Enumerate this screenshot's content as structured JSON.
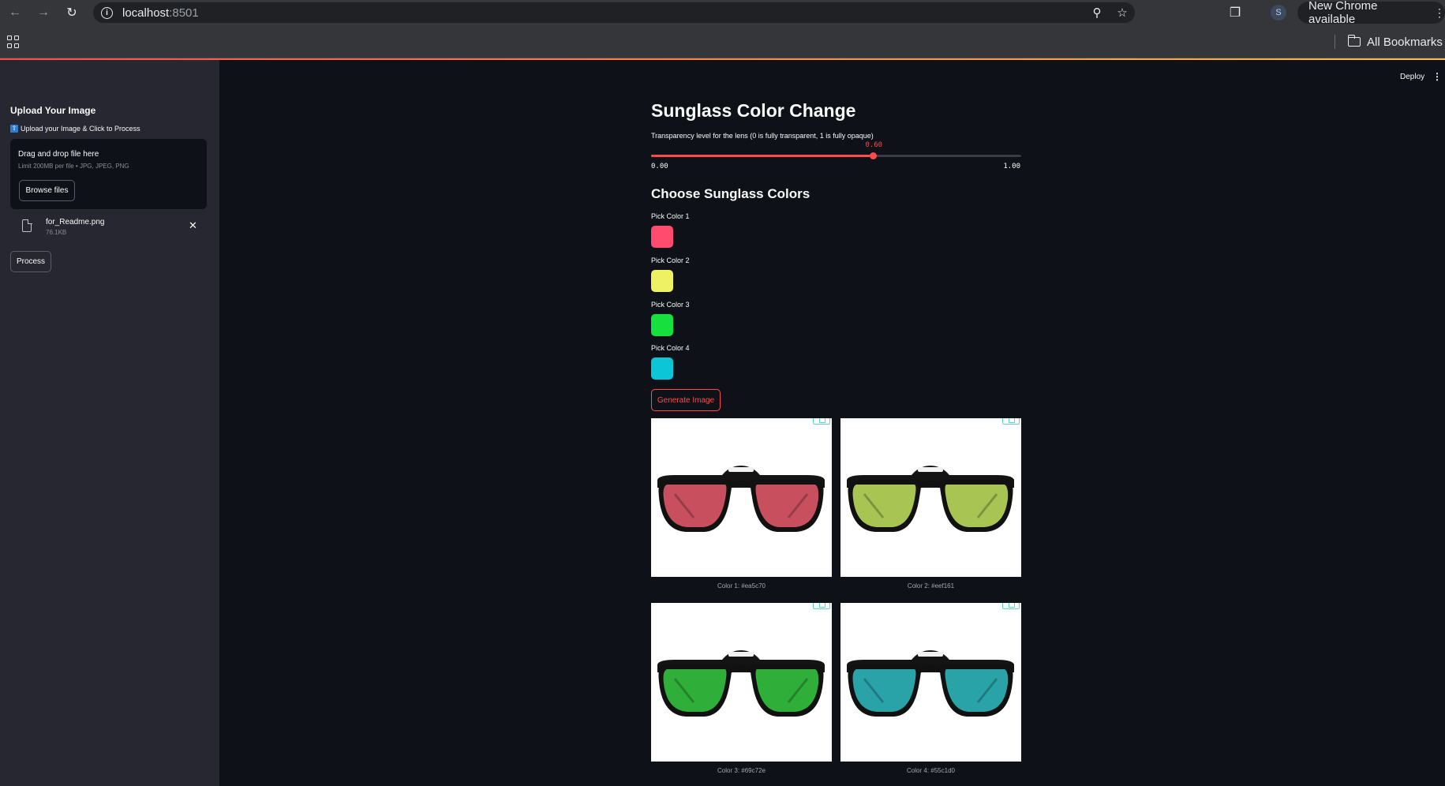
{
  "browser": {
    "url_host": "localhost",
    "url_port": ":8501",
    "new_chrome_label": "New Chrome available",
    "bookmarks_label": "All Bookmarks",
    "profile_initial": "S"
  },
  "sidebar": {
    "title": "Upload Your Image",
    "upload_hint": "Upload your Image & Click to Process",
    "dropzone_title": "Drag and drop file here",
    "dropzone_limit": "Limit 200MB per file • JPG, JPEG, PNG",
    "browse_label": "Browse files",
    "file": {
      "name": "for_Readme.png",
      "size": "76.1KB"
    },
    "process_label": "Process"
  },
  "toolbar": {
    "deploy_label": "Deploy"
  },
  "main": {
    "title": "Sunglass Color Change",
    "slider": {
      "label": "Transparency level for the lens (0 is fully transparent, 1 is fully opaque)",
      "value": 0.6,
      "value_label": "0.60",
      "min_label": "0.00",
      "max_label": "1.00"
    },
    "colors_heading": "Choose Sunglass Colors",
    "pickers": [
      {
        "label": "Pick Color 1",
        "color": "#ff4c6e"
      },
      {
        "label": "Pick Color 2",
        "color": "#eef161"
      },
      {
        "label": "Pick Color 3",
        "color": "#16e03e"
      },
      {
        "label": "Pick Color 4",
        "color": "#0cc6d7"
      }
    ],
    "generate_label": "Generate Image",
    "results": [
      {
        "caption": "Color 1: #ea5c70",
        "lens": "#c8505e"
      },
      {
        "caption": "Color 2: #eef161",
        "lens": "#a8c453"
      },
      {
        "caption": "Color 3: #69c72e",
        "lens": "#2fae39"
      },
      {
        "caption": "Color 4: #55c1d0",
        "lens": "#2aa3a8"
      }
    ]
  }
}
